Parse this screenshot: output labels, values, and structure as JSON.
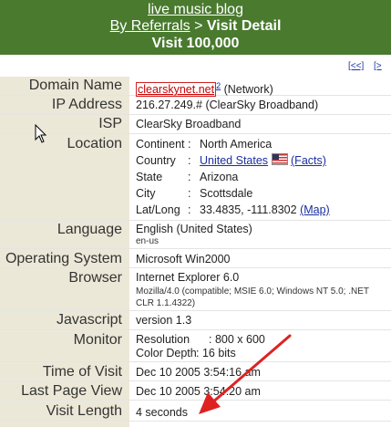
{
  "header": {
    "blog_title": "live music blog",
    "breadcrumb_link": "By Referrals",
    "breadcrumb_sep": " > ",
    "breadcrumb_current": "Visit Detail",
    "visit_label": "Visit 100,000"
  },
  "pager": {
    "prev": "[<<]",
    "next": "[>"
  },
  "rows": {
    "domain": {
      "label": "Domain Name",
      "link": "clearskynet.net",
      "sup": "2",
      "suffix": " (Network)"
    },
    "ip": {
      "label": "IP Address",
      "value": "216.27.249.# (ClearSky Broadband)"
    },
    "isp": {
      "label": "ISP",
      "value": "ClearSky Broadband"
    },
    "location": {
      "label": "Location",
      "continent_key": "Continent",
      "continent_val": "North America",
      "country_key": "Country",
      "country_val": "United States",
      "facts": "(Facts)",
      "state_key": "State",
      "state_val": "Arizona",
      "city_key": "City",
      "city_val": "Scottsdale",
      "latlong_key": "Lat/Long",
      "latlong_val": "33.4835, -111.8302",
      "map": "(Map)"
    },
    "language": {
      "label": "Language",
      "value": "English (United States)",
      "code": "en-us"
    },
    "os": {
      "label": "Operating System",
      "value": "Microsoft Win2000"
    },
    "browser": {
      "label": "Browser",
      "value": "Internet Explorer 6.0",
      "ua1": "Mozilla/4.0 (compatible; MSIE 6.0; Windows NT 5.0; .NET",
      "ua2": "CLR 1.1.4322)"
    },
    "javascript": {
      "label": "Javascript",
      "value": "version 1.3"
    },
    "monitor": {
      "label": "Monitor",
      "res_key": "Resolution",
      "res_val": ": 800 x 600",
      "depth_key": "Color Depth",
      "depth_val": ": 16 bits"
    },
    "time": {
      "label": "Time of Visit",
      "value": "Dec 10 2005 3:54:16 am"
    },
    "lastpage": {
      "label": "Last Page View",
      "value": "Dec 10 2005 3:54:20 am"
    },
    "length": {
      "label": "Visit Length",
      "value": "4 seconds"
    }
  },
  "colors": {
    "header_bg": "#497a2e",
    "label_bg": "#ece8d8",
    "link": "#1a2ea0",
    "arrow": "#dd2222"
  }
}
